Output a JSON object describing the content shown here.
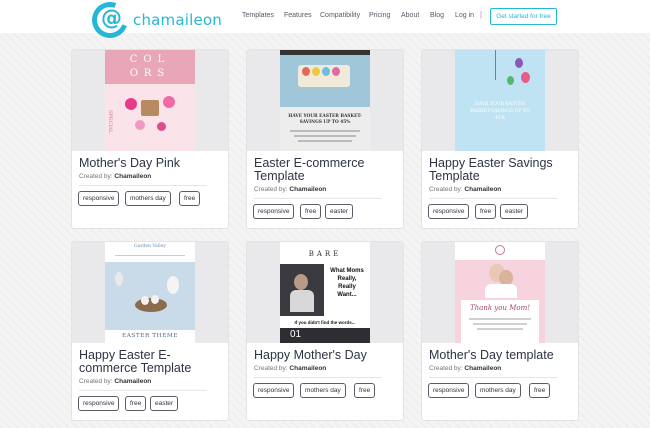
{
  "brand": {
    "name": "chamaileon",
    "accent": "#27b7d6"
  },
  "nav": {
    "items": [
      "Templates",
      "Features",
      "Compatibility",
      "Pricing",
      "About",
      "Blog",
      "Log in"
    ],
    "separator": "|",
    "cta": "Get started for free"
  },
  "cards": [
    {
      "title": "Mother's Day Pink",
      "creator_label": "Created by:",
      "creator": "Chamaileon",
      "tags": [
        "responsive",
        "mothers day",
        "free"
      ],
      "thumb": {
        "heading": "COL",
        "heading2": "ORS",
        "side": "SPECIAL",
        "bg": "#fbe3ea",
        "band": "#e8a6b6"
      }
    },
    {
      "title": "Easter E-commerce Template",
      "creator_label": "Created by:",
      "creator": "Chamaileon",
      "tags": [
        "responsive",
        "free",
        "easter"
      ],
      "thumb": {
        "line1": "HAVE YOUR EASTER BASKET-",
        "line2": "SAVINGS UP TO 45%",
        "bg": "#d9d9d9"
      }
    },
    {
      "title": "Happy Easter Savings Template",
      "creator_label": "Created by:",
      "creator": "Chamaileon",
      "tags": [
        "responsive",
        "free",
        "easter"
      ],
      "thumb": {
        "line1": "HAVE YOUR EASTER",
        "line2": "BASKET-SAVINGS UP TO",
        "line3": "45%",
        "bg": "#bfe3f2"
      }
    },
    {
      "title": "Happy Easter E-commerce Template",
      "creator_label": "Created by:",
      "creator": "Chamaileon",
      "tags": [
        "responsive",
        "free",
        "easter"
      ],
      "thumb": {
        "brand": "Garden Valley",
        "caption": "EASTER THEME",
        "bg": "#c9dbe8"
      }
    },
    {
      "title": "Happy Mother's Day",
      "creator_label": "Created by:",
      "creator": "Chamaileon",
      "tags": [
        "responsive",
        "mothers day",
        "free"
      ],
      "thumb": {
        "brand": "BARE",
        "line1": "What Moms",
        "line2": "Really,",
        "line3": "Really",
        "line4": "Want...",
        "line5": "If you didn't find the words...",
        "number": "01"
      }
    },
    {
      "title": "Mother's Day template",
      "creator_label": "Created by:",
      "creator": "Chamaileon",
      "tags": [
        "responsive",
        "mothers day",
        "free"
      ],
      "thumb": {
        "heading": "Thank you Mom!",
        "bg": "#f6d3dd"
      }
    }
  ]
}
